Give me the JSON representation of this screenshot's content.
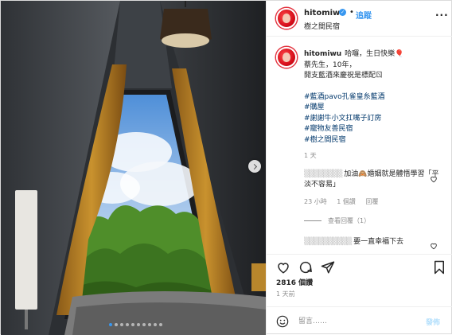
{
  "account": {
    "username": "hitomiwu",
    "verified_mark": "✓",
    "follow_label": "追蹤",
    "location": "樹之間民宿"
  },
  "caption": {
    "username": "hitomiwu",
    "lines": [
      "哈囉，生日快樂🎈",
      "蔡先生，10年，",
      "開支藍酒來慶祝是標配ㄖ"
    ],
    "hashtags": [
      "#藍酒pavo孔雀皇糸藍酒",
      "#購屋",
      "#謝謝牛小文扛嘴子訂房",
      "#寵物友善民宿",
      "#樹之間民宿"
    ],
    "time": "1 天"
  },
  "comments": [
    {
      "text": "加油🙈婚姻就是體悟學習「平淡不容易」",
      "time": "23 小時",
      "likes": "1 個讚",
      "reply_label": "回覆",
      "view_replies": "查看回覆（1）"
    },
    {
      "text": "要一直幸福下去"
    }
  ],
  "post": {
    "likes": "2816 個讚",
    "time_ago": "1 天前"
  },
  "add_comment": {
    "placeholder": "留言……",
    "post_label": "發佈"
  },
  "carousel": {
    "count": 10,
    "active_index": 0
  },
  "colors": {
    "link": "#3897f0",
    "hashtag": "#00376b",
    "muted": "#8e8e8e"
  },
  "icons": [
    "heart-icon",
    "comment-icon",
    "share-icon",
    "bookmark-icon",
    "emoji-icon",
    "more-options-icon",
    "next-arrow-icon"
  ]
}
